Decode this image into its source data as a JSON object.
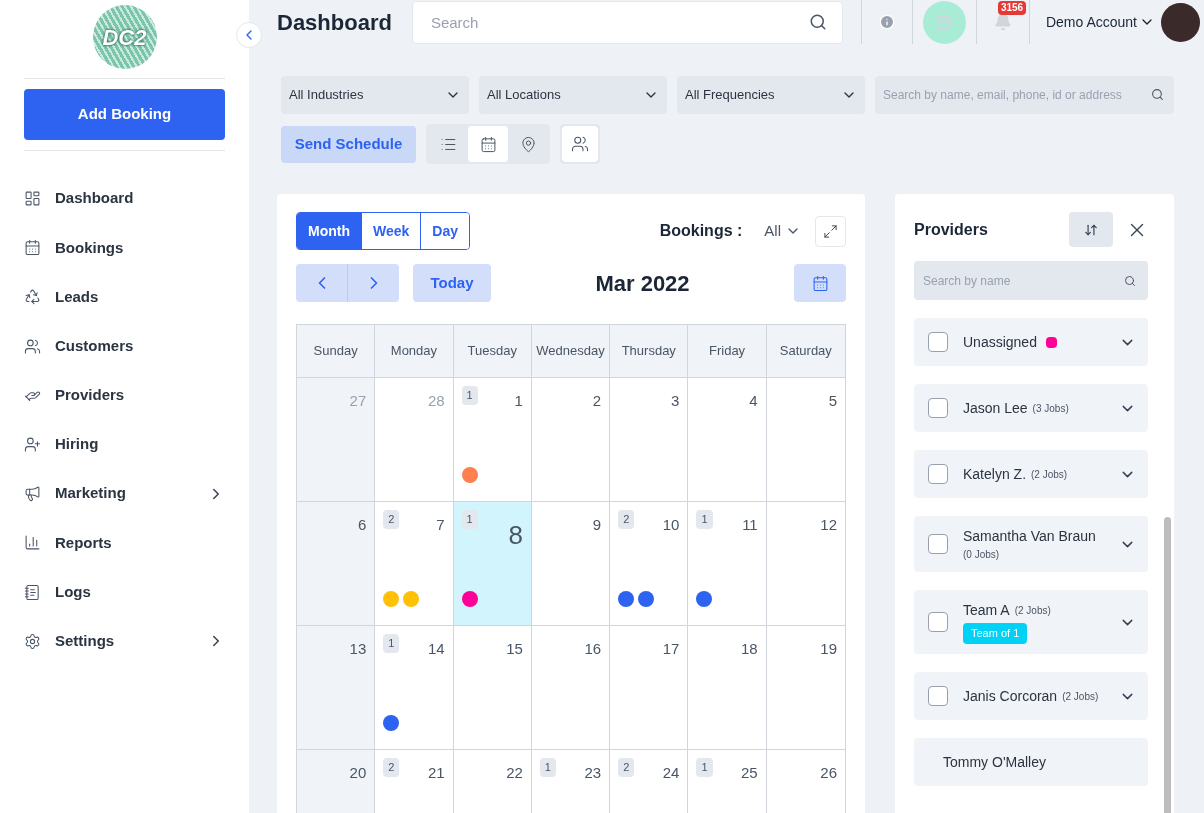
{
  "logo": {
    "text": "DC2"
  },
  "sidebar": {
    "add_button": "Add Booking",
    "items": [
      {
        "label": "Dashboard",
        "expandable": false
      },
      {
        "label": "Bookings",
        "expandable": false
      },
      {
        "label": "Leads",
        "expandable": false
      },
      {
        "label": "Customers",
        "expandable": false
      },
      {
        "label": "Providers",
        "expandable": false
      },
      {
        "label": "Hiring",
        "expandable": false
      },
      {
        "label": "Marketing",
        "expandable": true
      },
      {
        "label": "Reports",
        "expandable": false
      },
      {
        "label": "Logs",
        "expandable": false
      },
      {
        "label": "Settings",
        "expandable": true
      }
    ]
  },
  "header": {
    "title": "Dashboard",
    "search": {
      "placeholder": "Search"
    },
    "notification_count": "3156",
    "account": "Demo Account"
  },
  "filters": {
    "dropdowns": [
      "All Industries",
      "All Locations",
      "All Frequencies"
    ],
    "search": {
      "placeholder": "Search by name, email, phone, id or address"
    },
    "send_button": "Send Schedule",
    "views": [
      {
        "kind": "list",
        "selected": false
      },
      {
        "kind": "calendar",
        "selected": true
      },
      {
        "kind": "map",
        "selected": false
      }
    ]
  },
  "calendar": {
    "views": [
      {
        "label": "Month",
        "selected": true
      },
      {
        "label": "Week",
        "selected": false
      },
      {
        "label": "Day",
        "selected": false
      }
    ],
    "bookings_label": "Bookings :",
    "bookings_filter": "All",
    "today_button": "Today",
    "month": "Mar 2022",
    "weekdays": [
      "Sunday",
      "Monday",
      "Tuesday",
      "Wednesday",
      "Thursday",
      "Friday",
      "Saturday"
    ],
    "weeks": [
      [
        {
          "day": "27",
          "muted": true
        },
        {
          "day": "28",
          "muted": true
        },
        {
          "day": "1",
          "count": "1",
          "dots": [
            {
              "color": "#ff7f50"
            }
          ]
        },
        {
          "day": "2"
        },
        {
          "day": "3"
        },
        {
          "day": "4"
        },
        {
          "day": "5"
        }
      ],
      [
        {
          "day": "6"
        },
        {
          "day": "7",
          "count": "2",
          "dots": [
            {
              "color": "#ffc107"
            },
            {
              "color": "#ffc107"
            }
          ]
        },
        {
          "day": "8",
          "count": "1",
          "today": true,
          "dots": [
            {
              "color": "#ff0099"
            }
          ]
        },
        {
          "day": "9"
        },
        {
          "day": "10",
          "count": "2",
          "dots": [
            {
              "color": "#2e62f0"
            },
            {
              "color": "#2e62f0"
            }
          ]
        },
        {
          "day": "11",
          "count": "1",
          "dots": [
            {
              "color": "#2e62f0"
            }
          ]
        },
        {
          "day": "12"
        }
      ],
      [
        {
          "day": "13"
        },
        {
          "day": "14",
          "count": "1",
          "dots": [
            {
              "color": "#2e62f0"
            }
          ]
        },
        {
          "day": "15"
        },
        {
          "day": "16"
        },
        {
          "day": "17"
        },
        {
          "day": "18"
        },
        {
          "day": "19"
        }
      ],
      [
        {
          "day": "20"
        },
        {
          "day": "21",
          "count": "2"
        },
        {
          "day": "22"
        },
        {
          "day": "23",
          "count": "1"
        },
        {
          "day": "24",
          "count": "2"
        },
        {
          "day": "25",
          "count": "1"
        },
        {
          "day": "26"
        }
      ]
    ]
  },
  "providers": {
    "title": "Providers",
    "search": {
      "placeholder": "Search by name"
    },
    "items": [
      {
        "name": "Unassigned",
        "checked": false,
        "color": "#ff0099"
      },
      {
        "name": "Jason Lee",
        "jobs": "(3 Jobs)",
        "checked": false
      },
      {
        "name": "Katelyn Z.",
        "jobs": "(2 Jobs)",
        "checked": false
      },
      {
        "name": "Samantha Van Braun",
        "jobs": "(0 Jobs)",
        "checked": false
      },
      {
        "name": "Team A",
        "jobs": "(2 Jobs)",
        "tag": "Team of 1",
        "checked": false
      },
      {
        "name": "Janis Corcoran",
        "jobs": "(2 Jobs)",
        "checked": false
      },
      {
        "name": "Tommy O'Malley"
      }
    ]
  }
}
